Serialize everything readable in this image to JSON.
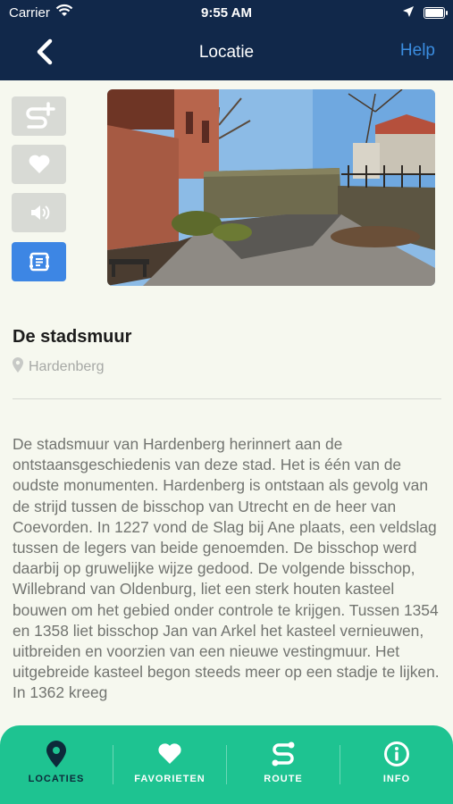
{
  "status_bar": {
    "carrier": "Carrier",
    "time": "9:55 AM"
  },
  "nav": {
    "title": "Locatie",
    "help_label": "Help"
  },
  "actions": [
    {
      "icon": "route-add-icon",
      "state": "disabled"
    },
    {
      "icon": "heart-icon",
      "state": "disabled"
    },
    {
      "icon": "speaker-icon",
      "state": "disabled"
    },
    {
      "icon": "info-card-icon",
      "state": "active"
    }
  ],
  "location": {
    "title": "De stadsmuur",
    "place": "Hardenberg",
    "description": "De stadsmuur van Hardenberg herinnert aan de ontstaansgeschiedenis van deze stad. Het is één van de oudste monumenten. Hardenberg is ontstaan als gevolg van de strijd tussen de bisschop van Utrecht en de heer van Coevorden. In 1227 vond de Slag bij Ane plaats, een veldslag tussen de legers van beide genoemden. De bisschop werd daarbij op gruwelijke wijze gedood. De volgende bisschop, Willebrand van Oldenburg, liet een sterk houten kasteel bouwen om het gebied onder controle te krijgen. Tussen 1354 en 1358 liet bisschop Jan van Arkel het kasteel vernieuwen, uitbreiden en voorzien van een nieuwe vestingmuur. Het uitgebreide kasteel begon steeds meer op een stadje te lijken. In 1362 kreeg"
  },
  "tabs": [
    {
      "label": "LOCATIES",
      "icon": "map-pin-icon",
      "selected": true
    },
    {
      "label": "FAVORIETEN",
      "icon": "heart-icon",
      "selected": false
    },
    {
      "label": "ROUTE",
      "icon": "route-icon",
      "selected": false
    },
    {
      "label": "INFO",
      "icon": "info-icon",
      "selected": false
    }
  ],
  "colors": {
    "header": "#11284a",
    "accent": "#3d86e4",
    "tabbar": "#1ec391",
    "background": "#f6f8ef"
  }
}
